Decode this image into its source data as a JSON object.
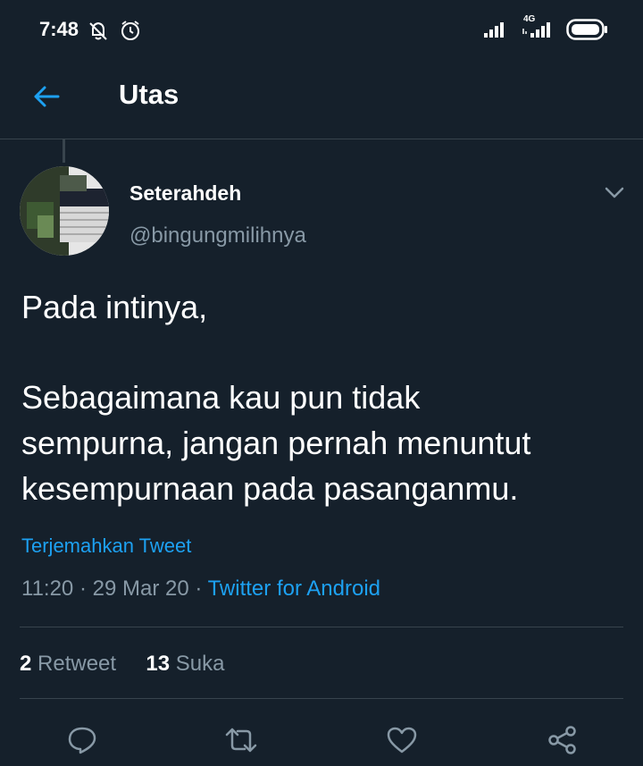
{
  "status_bar": {
    "time": "7:48",
    "network": "4G",
    "icons": [
      "notifications-off-icon",
      "alarm-icon",
      "signal-icon",
      "signal-4g-icon",
      "battery-icon"
    ]
  },
  "header": {
    "title": "Utas",
    "back_icon": "arrow-left-icon",
    "accent_color": "#1da1f2"
  },
  "tweet": {
    "author": {
      "display_name": "Seterahdeh",
      "handle": "@bingungmilihnya"
    },
    "text_lines": [
      "Pada intinya,",
      "Sebagaimana kau pun tidak",
      "sempurna, jangan pernah menuntut",
      "kesempurnaan pada pasanganmu."
    ],
    "translate_label": "Terjemahkan Tweet",
    "time": "11:20",
    "date": "29 Mar 20",
    "separator": "·",
    "source": "Twitter for Android",
    "stats": {
      "retweet_count": "2",
      "retweet_label": "Retweet",
      "like_count": "13",
      "like_label": "Suka"
    },
    "actions": [
      "reply-icon",
      "retweet-icon",
      "like-icon",
      "share-icon"
    ]
  },
  "colors": {
    "background": "#15202b",
    "secondary_text": "#8899a6",
    "divider": "#38444d",
    "link": "#1da1f2"
  }
}
